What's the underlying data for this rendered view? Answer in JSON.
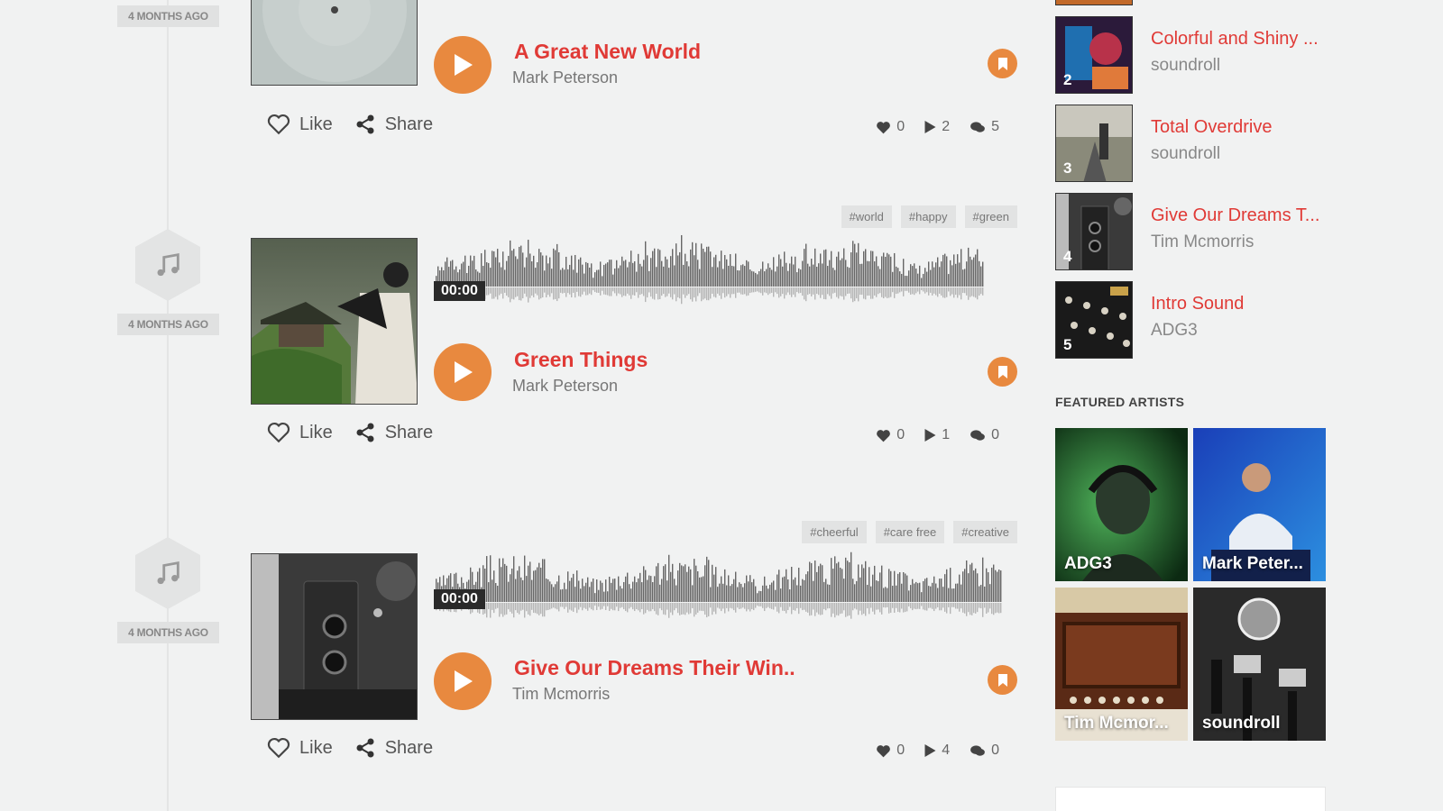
{
  "colors": {
    "accent": "#e03a36",
    "play": "#e8893f",
    "background": "#f1f2f2"
  },
  "feed": [
    {
      "time": "4 MONTHS AGO",
      "title": "A Great New World",
      "artist": "Mark Peterson",
      "tags": [],
      "likes": "0",
      "plays": "2",
      "comments": "5"
    },
    {
      "time": "4 MONTHS AGO",
      "title": "Green Things",
      "artist": "Mark Peterson",
      "tags": [
        "#world",
        "#happy",
        "#green"
      ],
      "time_display": "00:00",
      "likes": "0",
      "plays": "1",
      "comments": "0"
    },
    {
      "time": "4 MONTHS AGO",
      "title": "Give Our Dreams Their Win..",
      "artist": "Tim Mcmorris",
      "tags": [
        "#cheerful",
        "#care free",
        "#creative"
      ],
      "time_display": "00:00",
      "likes": "0",
      "plays": "4",
      "comments": "0"
    }
  ],
  "actions": {
    "like": "Like",
    "share": "Share"
  },
  "top_chart": [
    {
      "rank": "2",
      "title": "Colorful and Shiny ...",
      "artist": "soundroll"
    },
    {
      "rank": "3",
      "title": "Total Overdrive",
      "artist": "soundroll"
    },
    {
      "rank": "4",
      "title": "Give Our Dreams T...",
      "artist": "Tim Mcmorris"
    },
    {
      "rank": "5",
      "title": "Intro Sound",
      "artist": "ADG3"
    }
  ],
  "featured_artists": {
    "heading": "FEATURED ARTISTS",
    "items": [
      {
        "name": "ADG3"
      },
      {
        "name": "Mark Peter..."
      },
      {
        "name": "Tim Mcmor..."
      },
      {
        "name": "soundroll"
      }
    ]
  },
  "icons": {
    "play": "play-icon",
    "bookmark": "bookmark-icon",
    "like": "heart-outline-icon",
    "share": "share-icon",
    "music": "music-note-icon",
    "heart": "heart-icon",
    "plays": "play-count-icon",
    "comments": "comment-icon"
  }
}
